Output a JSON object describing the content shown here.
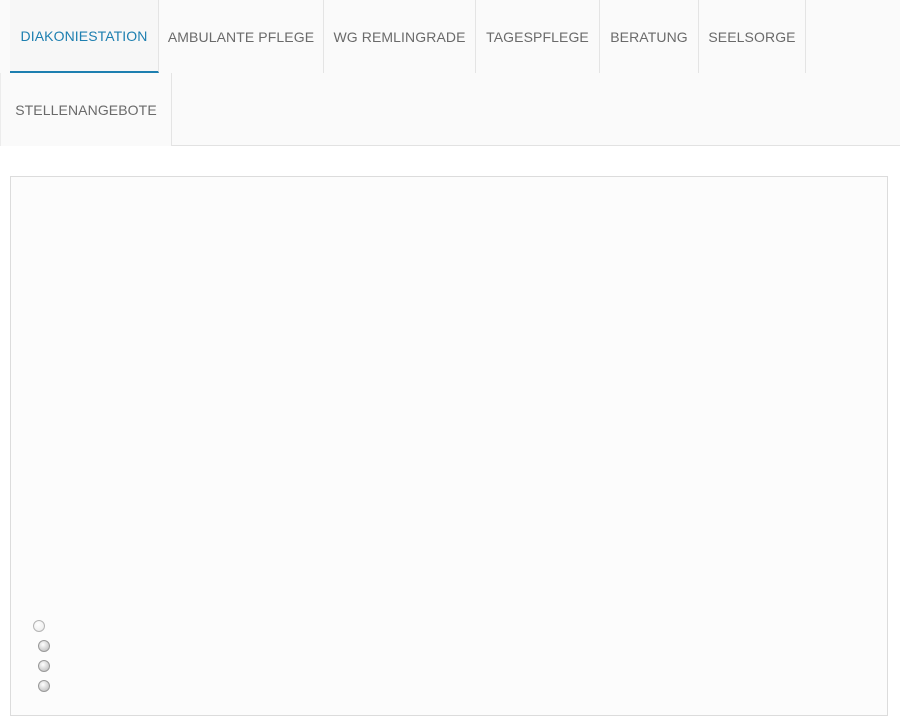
{
  "nav": {
    "items": [
      {
        "label": "DIAKONIESTATION",
        "active": true
      },
      {
        "label": "AMBULANTE PFLEGE",
        "active": false
      },
      {
        "label": "WG REMLINGRADE",
        "active": false
      },
      {
        "label": "TAGESPFLEGE",
        "active": false
      },
      {
        "label": "BERATUNG",
        "active": false
      },
      {
        "label": "SEELSORGE",
        "active": false
      },
      {
        "label": "STELLENANGEBOTE",
        "active": false
      }
    ]
  },
  "colors": {
    "accent": "#1d7fb0",
    "nav_text": "#6a6a6a",
    "nav_background": "#fafafa",
    "slider_border": "#dcdcdc"
  },
  "slider": {
    "slide_count": 4,
    "active_slide": 1
  }
}
